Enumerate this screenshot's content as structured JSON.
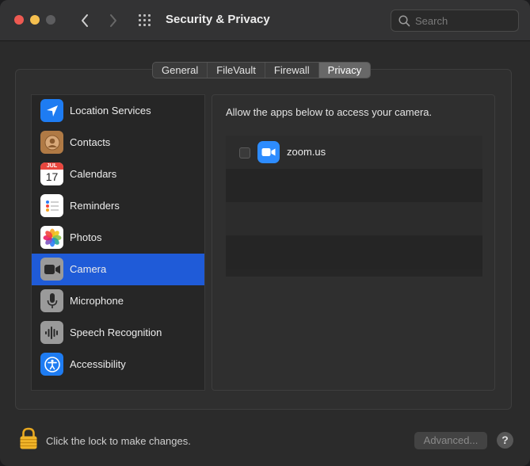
{
  "window": {
    "title": "Security & Privacy"
  },
  "search": {
    "placeholder": "Search",
    "value": ""
  },
  "tabs": [
    {
      "label": "General",
      "active": false
    },
    {
      "label": "FileVault",
      "active": false
    },
    {
      "label": "Firewall",
      "active": false
    },
    {
      "label": "Privacy",
      "active": true
    }
  ],
  "sidebar": {
    "selected": "Camera",
    "items": [
      {
        "label": "Location Services",
        "icon": "location-arrow-icon"
      },
      {
        "label": "Contacts",
        "icon": "contacts-icon"
      },
      {
        "label": "Calendars",
        "icon": "calendar-icon",
        "icon_month": "JUL",
        "icon_day": "17"
      },
      {
        "label": "Reminders",
        "icon": "reminders-icon"
      },
      {
        "label": "Photos",
        "icon": "photos-icon"
      },
      {
        "label": "Camera",
        "icon": "camera-icon"
      },
      {
        "label": "Microphone",
        "icon": "microphone-icon"
      },
      {
        "label": "Speech Recognition",
        "icon": "waveform-icon"
      },
      {
        "label": "Accessibility",
        "icon": "accessibility-icon"
      }
    ]
  },
  "panel": {
    "heading": "Allow the apps below to access your camera.",
    "apps": [
      {
        "name": "zoom.us",
        "checked": false,
        "icon": "zoom-icon"
      }
    ]
  },
  "footer": {
    "lock_text": "Click the lock to make changes.",
    "advanced_label": "Advanced...",
    "help_label": "?"
  },
  "colors": {
    "selection": "#1f5bd8",
    "zoom_blue": "#2d8cff",
    "close": "#ee5a52",
    "minimize": "#f5bf4f",
    "lock_gold": "#f0b429"
  }
}
